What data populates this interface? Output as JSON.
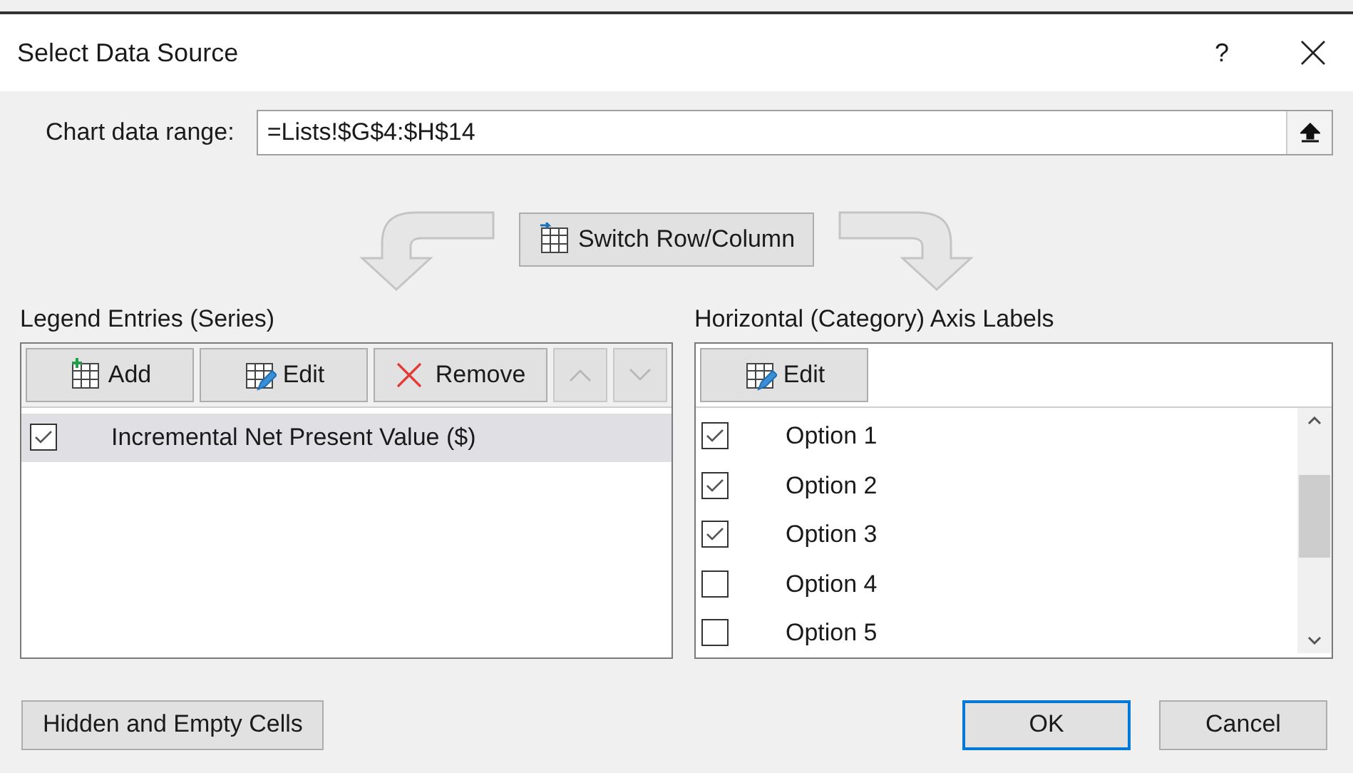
{
  "window": {
    "title": "Select Data Source",
    "help": "?"
  },
  "range": {
    "label": "Chart data range:",
    "value": "=Lists!$G$4:$H$14"
  },
  "switch_button": "Switch Row/Column",
  "legend": {
    "heading": "Legend Entries (Series)",
    "buttons": [
      {
        "kind": "add",
        "label": "Add"
      },
      {
        "kind": "edit",
        "label": "Edit"
      },
      {
        "kind": "remove",
        "label": "Remove"
      },
      {
        "kind": "up"
      },
      {
        "kind": "down"
      }
    ],
    "items": [
      {
        "label": "Incremental Net Present Value ($)",
        "checked": true,
        "selected": true
      }
    ]
  },
  "axis": {
    "heading": "Horizontal (Category) Axis Labels",
    "buttons": [
      {
        "kind": "edit",
        "label": "Edit"
      }
    ],
    "items": [
      {
        "label": "Option 1",
        "checked": true
      },
      {
        "label": "Option 2",
        "checked": true
      },
      {
        "label": "Option 3",
        "checked": true
      },
      {
        "label": "Option 4",
        "checked": false
      },
      {
        "label": "Option 5",
        "checked": false
      }
    ]
  },
  "footer": {
    "hidden_button": "Hidden and Empty Cells",
    "ok": "OK",
    "cancel": "Cancel"
  }
}
